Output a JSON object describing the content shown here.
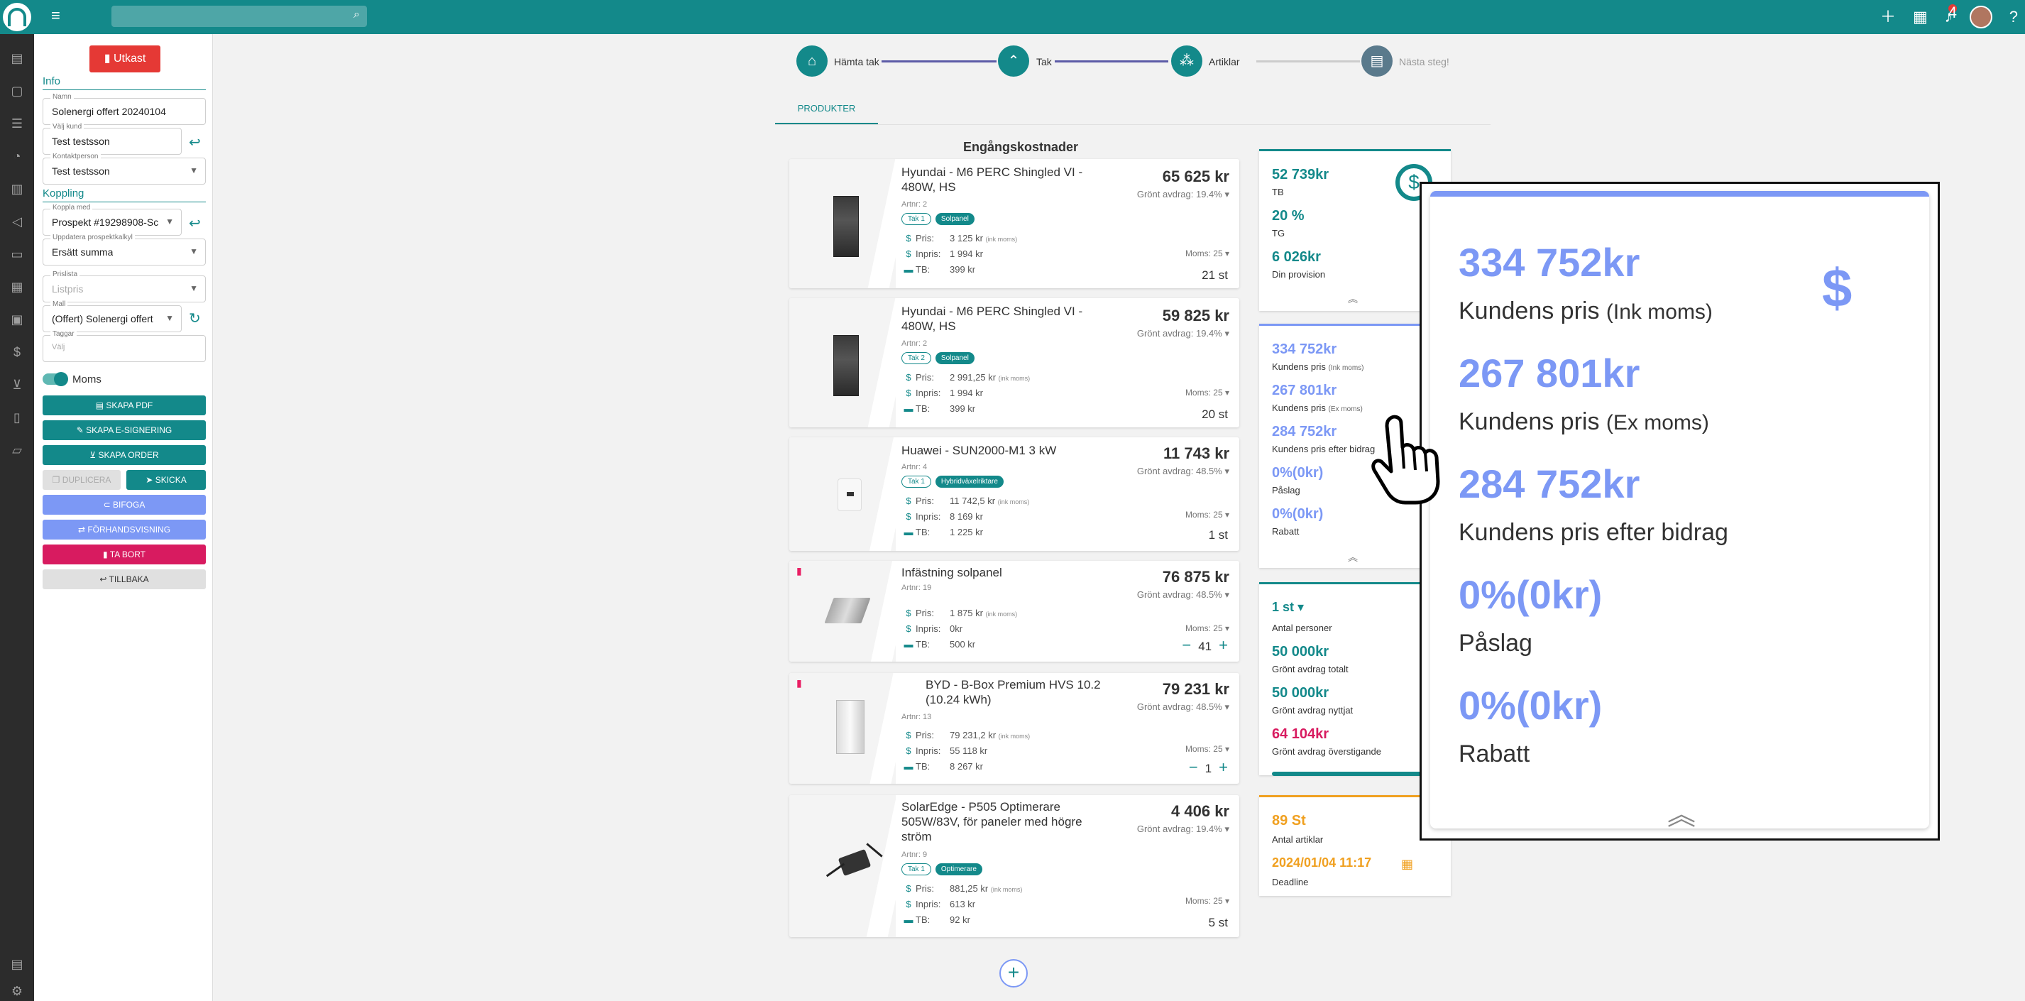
{
  "topbar": {
    "menu_icon": "hamburger-icon",
    "search_icon": "search-icon",
    "icons": [
      "plus-icon",
      "calendar-icon",
      "bell-icon",
      "avatar",
      "help-icon"
    ],
    "notification_count": "4",
    "help": "?"
  },
  "left": {
    "draft_label": "Utkast",
    "info_title": "Info",
    "namn_label": "Namn",
    "namn_value": "Solenergi offert 20240104",
    "kund_label": "Välj kund",
    "kund_value": "Test testsson",
    "kontakt_label": "Kontaktperson",
    "kontakt_value": "Test testsson",
    "koppling_title": "Koppling",
    "koppla_label": "Koppla med",
    "koppla_value": "Prospekt #19298908-Sc",
    "uppdatera_label": "Uppdatera prospektkalkyl",
    "uppdatera_value": "Ersätt summa",
    "prislista_label": "Prislista",
    "prislista_value": "Listpris",
    "mall_label": "Mall",
    "mall_value": "(Offert) Solenergi offert",
    "taggar_label": "Taggar",
    "taggar_placeholder": "Välj",
    "moms_label": "Moms",
    "btn_pdf": "Skapa PDF",
    "btn_esign": "Skapa E-signering",
    "btn_order": "Skapa order",
    "btn_duplicera": "Duplicera",
    "btn_skicka": "Skicka",
    "btn_bifoga": "Bifoga",
    "btn_preview": "Förhandsvisning",
    "btn_delete": "Ta bort",
    "btn_back": "Tillbaka"
  },
  "stepper": {
    "steps": [
      "Hämta tak",
      "Tak",
      "Artiklar",
      "Nästa steg!"
    ]
  },
  "tab": "PRODUKTER",
  "group_title": "Engångskostnader",
  "labels": {
    "pris": "Pris:",
    "inpris": "Inpris:",
    "tb": "TB:",
    "ink_moms": "(ink moms)",
    "gront": "Grönt avdrag:",
    "moms": "Moms:"
  },
  "products": [
    {
      "title": "Hyundai - M6 PERC Shingled VI - 480W, HS",
      "art": "Artnr: 2",
      "tak": "Tak 1",
      "cat": "Solpanel",
      "pris": "3 125 kr",
      "inpris": "1 994 kr",
      "tb": "399 kr",
      "price": "65 625 kr",
      "gront": "19.4%",
      "moms": "25",
      "qty": "21 st"
    },
    {
      "title": "Hyundai - M6 PERC Shingled VI - 480W, HS",
      "art": "Artnr: 2",
      "tak": "Tak 2",
      "cat": "Solpanel",
      "pris": "2 991,25 kr",
      "inpris": "1 994 kr",
      "tb": "399 kr",
      "price": "59 825 kr",
      "gront": "19.4%",
      "moms": "25",
      "qty": "20 st"
    },
    {
      "title": "Huawei - SUN2000-M1 3 kW",
      "art": "Artnr: 4",
      "tak": "Tak 1",
      "cat": "Hybridväxelriktare",
      "pris": "11 742,5 kr",
      "inpris": "8 169 kr",
      "tb": "1 225 kr",
      "price": "11 743 kr",
      "gront": "48.5%",
      "moms": "25",
      "qty": "1 st"
    },
    {
      "title": "Infästning solpanel",
      "art": "Artnr: 19",
      "pris": "1 875 kr",
      "inpris": "0kr",
      "tb": "500 kr",
      "price": "76 875 kr",
      "gront": "48.5%",
      "moms": "25",
      "qty": "41"
    },
    {
      "title": "BYD - B-Box Premium HVS 10.2 (10.24 kWh)",
      "art": "Artnr: 13",
      "pris": "79 231,2 kr",
      "inpris": "55 118 kr",
      "tb": "8 267 kr",
      "price": "79 231 kr",
      "gront": "48.5%",
      "moms": "25",
      "qty": "1"
    },
    {
      "title": "SolarEdge - P505 Optimerare 505W/83V, för paneler med högre ström",
      "art": "Artnr: 9",
      "tak": "Tak 1",
      "cat": "Optimerare",
      "pris": "881,25 kr",
      "inpris": "613 kr",
      "tb": "92 kr",
      "price": "4 406 kr",
      "gront": "19.4%",
      "moms": "25",
      "qty": "5 st"
    }
  ],
  "summary": {
    "tb_value": "52 739kr",
    "tb_label": "TB",
    "tg_value": "20 %",
    "tg_label": "TG",
    "prov_value": "6 026kr",
    "prov_label": "Din provision",
    "kp_ink": "334 752kr",
    "kp_label": "Kundens pris",
    "ink_moms": "(Ink moms)",
    "kp_ex": "267 801kr",
    "ex_moms": "(Ex moms)",
    "kp_efter": "284 752kr",
    "kp_efter_label": "Kundens pris efter bidrag",
    "paslag": "0%(0kr)",
    "paslag_label": "Påslag",
    "rabatt": "0%(0kr)",
    "rabatt_label": "Rabatt",
    "antal_personer_value": "1 st",
    "antal_personer_label": "Antal personer",
    "gront_totalt": "50 000kr",
    "gront_totalt_label": "Grönt avdrag totalt",
    "gront_nyttjat": "50 000kr",
    "gront_nyttjat_label": "Grönt avdrag nyttjat",
    "gront_over": "64 104kr",
    "gront_over_label": "Grönt avdrag överstigande",
    "antal_artiklar": "89 St",
    "antal_artiklar_label": "Antal artiklar",
    "deadline": "2024/01/04 11:17",
    "deadline_label": "Deadline"
  },
  "zoom": {
    "kp_ink": "334 752kr",
    "kp_label": "Kundens pris",
    "ink_moms": "(Ink moms)",
    "kp_ex": "267 801kr",
    "ex_moms": "(Ex moms)",
    "kp_efter": "284 752kr",
    "kp_efter_label": "Kundens pris efter bidrag",
    "paslag": "0%(0kr)",
    "paslag_label": "Påslag",
    "rabatt": "0%(0kr)",
    "rabatt_label": "Rabatt",
    "dollar": "$"
  },
  "colors": {
    "primary": "#13898a",
    "accent_blue": "#7c98f5",
    "danger": "#e53935",
    "pink": "#d81b60",
    "orange": "#f0a020"
  }
}
